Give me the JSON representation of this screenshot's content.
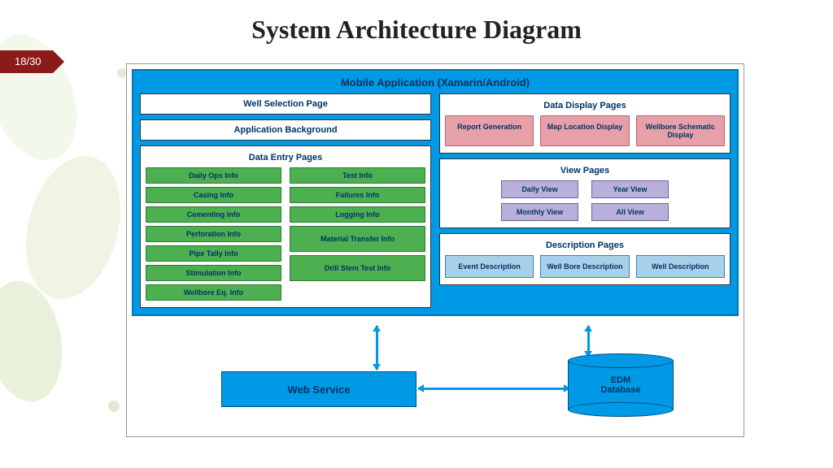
{
  "slide": {
    "title": "System Architecture Diagram",
    "page_badge": "18/30"
  },
  "mobile_app": {
    "title": "Mobile Application (Xamarin/Android)",
    "well_selection": "Well Selection Page",
    "app_background": "Application Background",
    "data_entry": {
      "title": "Data Entry Pages",
      "left": [
        "Daily Ops Info",
        "Casing Info",
        "Cementing Info",
        "Perforation Info",
        "Pipe Tally Info",
        "Stimulation Info",
        "Wellbore Eq. Info"
      ],
      "right": [
        "Test Info",
        "Failures Info",
        "Logging Info",
        "Material Transfer Info",
        "Drill Stem Test Info"
      ]
    },
    "data_display": {
      "title": "Data Display Pages",
      "items": [
        "Report Generation",
        "Map Location Display",
        "Wellbore Schematic Display"
      ]
    },
    "view_pages": {
      "title": "View Pages",
      "items": [
        "Daily View",
        "Year View",
        "Monthly View",
        "All View"
      ]
    },
    "description_pages": {
      "title": "Description Pages",
      "items": [
        "Event Description",
        "Well Bore Description",
        "Well Description"
      ]
    }
  },
  "web_service": "Web Service",
  "edm_db_line1": "EDM",
  "edm_db_line2": "Database"
}
